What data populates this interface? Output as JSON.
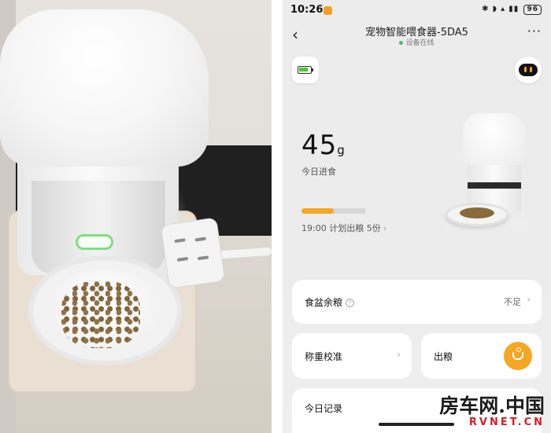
{
  "photo": {
    "alt": "pet feeder photo"
  },
  "status_bar": {
    "time": "10:26",
    "icons": "✱ ◗ ▴ ▮▮",
    "battery": "96"
  },
  "header": {
    "back_icon": "‹",
    "title": "宠物智能喂食器-5DA5",
    "subtitle": "设备在线",
    "more_icon": "···"
  },
  "summary": {
    "grams": "45",
    "unit": "g",
    "label": "今日进食",
    "progress_fraction": 0.5,
    "plan": "19:00 计划出粮 5份",
    "plan_chevron": "›"
  },
  "cards": {
    "bowl": {
      "label": "食盆余粮",
      "help_icon": "?",
      "value": "不足",
      "chevron": "›"
    },
    "calibrate": {
      "label": "称重校准",
      "chevron": "›"
    },
    "feed": {
      "label": "出粮"
    },
    "record": {
      "label": "今日记录"
    }
  },
  "watermark": {
    "chinese": "房车网.中国",
    "english": "RVNET.CN"
  },
  "colors": {
    "accent": "#f5a623",
    "online": "#45c06a",
    "background": "#ececec"
  }
}
